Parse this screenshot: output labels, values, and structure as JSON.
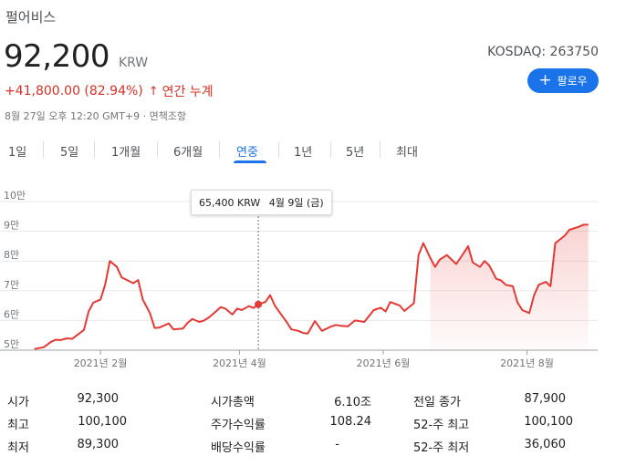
{
  "company_name": "펄어비스",
  "price": "92,200",
  "currency": "KRW",
  "exchange": "KOSDAQ: 263750",
  "change": "+41,800.00 (82.94%)",
  "change_arrow": "↑",
  "change_period": "연간 누계",
  "follow_button": "팔로우",
  "timestamp": "8월 27일 오후 12:20 GMT+9 · 면책조항",
  "tabs": [
    "1일",
    "5일",
    "1개월",
    "6개월",
    "연중",
    "1년",
    "5년",
    "최대"
  ],
  "active_tab": "연중",
  "tooltip": {
    "price": "65,400 KRW",
    "date": "4월 9일 (금)"
  },
  "colors": {
    "accent": "#1a73e8",
    "line": "#e53935",
    "negative_text": "#d93025"
  },
  "chart_data": {
    "type": "area",
    "title": "",
    "xlabel": "",
    "ylabel": "",
    "y_tick_labels": [
      "5만",
      "6만",
      "7만",
      "8만",
      "9만",
      "10만"
    ],
    "y_ticks": [
      50000,
      60000,
      70000,
      80000,
      90000,
      100000
    ],
    "ylim": [
      50000,
      100000
    ],
    "x_tick_labels": [
      "2021년 2월",
      "2021년 4월",
      "2021년 6월",
      "2021년 8월"
    ],
    "x_ticks": [
      "2021-02-01",
      "2021-04-01",
      "2021-06-01",
      "2021-08-01"
    ],
    "grid": true,
    "series": [
      {
        "x": [
          "2021-01-04",
          "2021-01-06",
          "2021-01-08",
          "2021-01-11",
          "2021-01-13",
          "2021-01-15",
          "2021-01-18",
          "2021-01-20",
          "2021-01-22",
          "2021-01-25",
          "2021-01-27",
          "2021-01-29",
          "2021-02-01",
          "2021-02-03",
          "2021-02-05",
          "2021-02-08",
          "2021-02-10",
          "2021-02-15",
          "2021-02-17",
          "2021-02-19",
          "2021-02-22",
          "2021-02-24",
          "2021-02-26",
          "2021-03-02",
          "2021-03-04",
          "2021-03-08",
          "2021-03-10",
          "2021-03-12",
          "2021-03-15",
          "2021-03-17",
          "2021-03-19",
          "2021-03-22",
          "2021-03-24",
          "2021-03-26",
          "2021-03-29",
          "2021-03-31",
          "2021-04-02",
          "2021-04-05",
          "2021-04-07",
          "2021-04-09",
          "2021-04-12",
          "2021-04-14",
          "2021-04-16",
          "2021-04-19",
          "2021-04-21",
          "2021-04-23",
          "2021-04-26",
          "2021-04-28",
          "2021-04-30",
          "2021-05-03",
          "2021-05-06",
          "2021-05-10",
          "2021-05-12",
          "2021-05-14",
          "2021-05-17",
          "2021-05-20",
          "2021-05-24",
          "2021-05-26",
          "2021-05-28",
          "2021-05-31",
          "2021-06-02",
          "2021-06-04",
          "2021-06-08",
          "2021-06-10",
          "2021-06-14",
          "2021-06-16",
          "2021-06-18",
          "2021-06-21",
          "2021-06-23",
          "2021-06-25",
          "2021-06-28",
          "2021-06-30",
          "2021-07-02",
          "2021-07-05",
          "2021-07-07",
          "2021-07-09",
          "2021-07-12",
          "2021-07-14",
          "2021-07-16",
          "2021-07-19",
          "2021-07-21",
          "2021-07-23",
          "2021-07-26",
          "2021-07-28",
          "2021-07-30",
          "2021-08-02",
          "2021-08-04",
          "2021-08-06",
          "2021-08-09",
          "2021-08-11",
          "2021-08-13",
          "2021-08-17",
          "2021-08-19",
          "2021-08-23",
          "2021-08-25",
          "2021-08-27"
        ],
        "values": [
          50400,
          50700,
          51000,
          52800,
          53500,
          53400,
          54000,
          53800,
          55000,
          56800,
          63000,
          66000,
          67000,
          72000,
          80000,
          78000,
          74500,
          72500,
          73600,
          67000,
          62500,
          57500,
          57600,
          59000,
          57000,
          57300,
          59200,
          60500,
          59500,
          60000,
          61000,
          63000,
          64500,
          64000,
          62000,
          64000,
          63500,
          64800,
          64200,
          65400,
          66200,
          68500,
          65000,
          61700,
          59500,
          57000,
          56500,
          55800,
          55600,
          59800,
          56500,
          58000,
          58500,
          58200,
          58000,
          60000,
          59500,
          61500,
          63500,
          64300,
          63000,
          66200,
          65000,
          63200,
          65800,
          82000,
          86000,
          81000,
          78000,
          80500,
          82000,
          80500,
          79000,
          82500,
          85000,
          79500,
          78000,
          80000,
          78500,
          74000,
          73500,
          72000,
          71500,
          66000,
          63500,
          62500,
          68500,
          72000,
          73000,
          71500,
          86000,
          88500,
          90500,
          91500,
          92200,
          92200
        ]
      }
    ]
  },
  "stats": [
    [
      {
        "label": "시가",
        "value": "92,300"
      },
      {
        "label": "최고",
        "value": "100,100"
      },
      {
        "label": "최저",
        "value": "89,300"
      }
    ],
    [
      {
        "label": "시가총액",
        "value": "6.10조"
      },
      {
        "label": "주가수익률",
        "value": "108.24"
      },
      {
        "label": "배당수익률",
        "value": "-"
      }
    ],
    [
      {
        "label": "전일 종가",
        "value": "87,900"
      },
      {
        "label": "52-주 최고",
        "value": "100,100"
      },
      {
        "label": "52-주 최저",
        "value": "36,060"
      }
    ]
  ]
}
